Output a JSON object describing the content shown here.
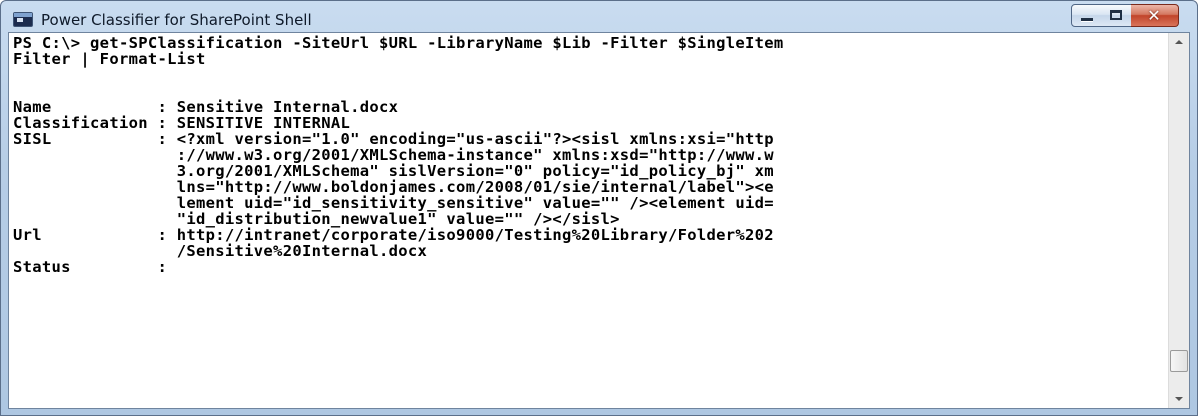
{
  "window": {
    "title": "Power Classifier for SharePoint Shell",
    "controls": {
      "minimize_icon": "minimize-icon",
      "maximize_icon": "maximize-icon",
      "close_icon": "close-icon",
      "close_glyph": "✕"
    }
  },
  "console": {
    "command": [
      "PS C:\\> get-SPClassification -SiteUrl $URL -LibraryName $Lib -Filter $SingleItem",
      "Filter | Format-List"
    ],
    "blank_lines": 2,
    "output": [
      "Name           : Sensitive Internal.docx",
      "Classification : SENSITIVE INTERNAL",
      "SISL           : <?xml version=\"1.0\" encoding=\"us-ascii\"?><sisl xmlns:xsi=\"http",
      "                 ://www.w3.org/2001/XMLSchema-instance\" xmlns:xsd=\"http://www.w",
      "                 3.org/2001/XMLSchema\" sislVersion=\"0\" policy=\"id_policy_bj\" xm",
      "                 lns=\"http://www.boldonjames.com/2008/01/sie/internal/label\"><e",
      "                 lement uid=\"id_sensitivity_sensitive\" value=\"\" /><element uid=",
      "                 \"id_distribution_newvalue1\" value=\"\" /></sisl>",
      "Url            : http://intranet/corporate/iso9000/Testing%20Library/Folder%202",
      "                 /Sensitive%20Internal.docx",
      "Status         :"
    ]
  },
  "colors": {
    "console_background": "#ffffff",
    "console_text": "#000000",
    "titlebar": "#b6cde6",
    "close_button": "#c1442a"
  }
}
